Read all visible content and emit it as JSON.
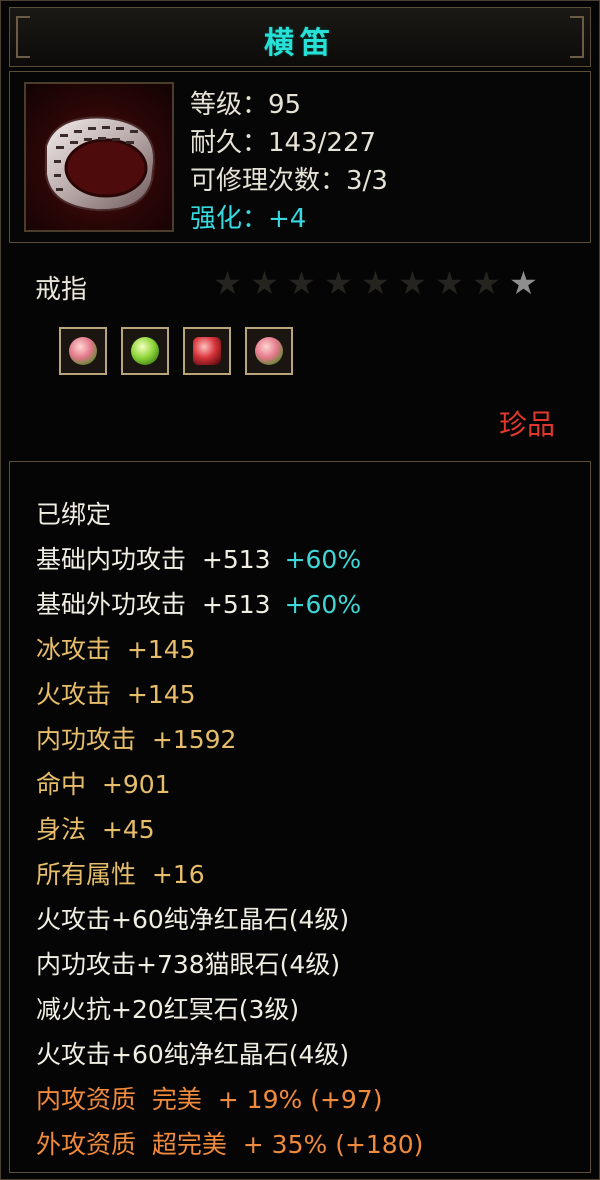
{
  "item": {
    "name": "横笛",
    "icon": "ring-icon",
    "stats": [
      {
        "label": "等级：",
        "value": "95"
      },
      {
        "label": "耐久：",
        "value": "143/227"
      },
      {
        "label": "可修理次数：",
        "value": "3/3"
      },
      {
        "label": "强化：",
        "value": "+4"
      }
    ],
    "type": "戒指",
    "stars_total": 9,
    "stars_lit": 1,
    "gems": [
      "pink-gem-icon",
      "green-gem-icon",
      "red-gem-icon",
      "pink-gem-icon"
    ],
    "rarity": "珍品"
  },
  "attributes": [
    {
      "text": "已绑定",
      "pct": "",
      "color": "white"
    },
    {
      "text": "基础内功攻击  +513",
      "pct": "+60%",
      "color": "white"
    },
    {
      "text": "基础外功攻击  +513",
      "pct": "+60%",
      "color": "white"
    },
    {
      "text": "冰攻击  +145",
      "pct": "",
      "color": "gold"
    },
    {
      "text": "火攻击  +145",
      "pct": "",
      "color": "gold"
    },
    {
      "text": "内功攻击  +1592",
      "pct": "",
      "color": "gold"
    },
    {
      "text": "命中  +901",
      "pct": "",
      "color": "gold"
    },
    {
      "text": "身法  +45",
      "pct": "",
      "color": "gold"
    },
    {
      "text": "所有属性  +16",
      "pct": "",
      "color": "gold"
    },
    {
      "text": "火攻击+60纯净红晶石(4级)",
      "pct": "",
      "color": "white"
    },
    {
      "text": "内功攻击+738猫眼石(4级)",
      "pct": "",
      "color": "white"
    },
    {
      "text": "减火抗+20红冥石(3级)",
      "pct": "",
      "color": "white"
    },
    {
      "text": "火攻击+60纯净红晶石(4级)",
      "pct": "",
      "color": "white"
    },
    {
      "text": "内攻资质  完美  + 19% (+97)",
      "pct": "",
      "color": "orange"
    },
    {
      "text": "外攻资质  超完美  + 35% (+180)",
      "pct": "",
      "color": "orange"
    }
  ],
  "colors": {
    "title": "#27e0d6",
    "rarity": "#e0382d",
    "gold": "#e6bd6a",
    "orange": "#f08a3c",
    "cyan": "#3fd7d7"
  }
}
